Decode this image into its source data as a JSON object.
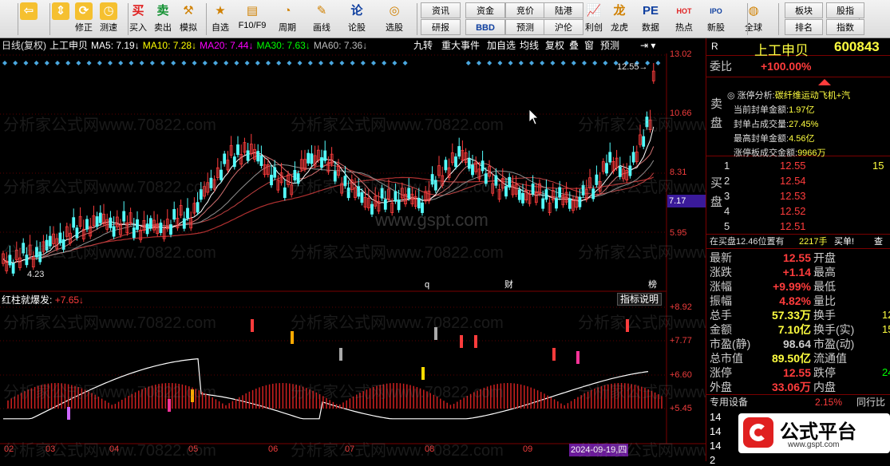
{
  "toolbar": {
    "items": [
      {
        "label": "",
        "icon": "back-arrow-icon"
      },
      {
        "label": "",
        "icon": "up-down-arrows-icon"
      },
      {
        "label": "修正",
        "icon": "refresh-icon"
      },
      {
        "label": "测速",
        "icon": "clock-icon"
      },
      {
        "label": "买入",
        "icon": "buy-icon",
        "glyph": "买"
      },
      {
        "label": "卖出",
        "icon": "sell-icon",
        "glyph": "卖"
      },
      {
        "label": "模拟",
        "icon": "gavel-icon"
      },
      {
        "label": "自选",
        "icon": "star-folder-icon"
      },
      {
        "label": "F10/F9",
        "icon": "f10-icon"
      },
      {
        "label": "周期",
        "icon": "cycle-icon"
      },
      {
        "label": "画线",
        "icon": "pen-icon"
      },
      {
        "label": "论股",
        "icon": "forum-icon",
        "glyph": "论"
      },
      {
        "label": "选股",
        "icon": "picker-icon"
      },
      {
        "label": "利创",
        "icon": "chart-icon"
      },
      {
        "label": "龙虎",
        "icon": "dragon-icon"
      },
      {
        "label": "数据",
        "icon": "pe-icon",
        "glyph": "PE"
      },
      {
        "label": "热点",
        "icon": "hot-icon",
        "glyph": "HOT"
      },
      {
        "label": "新股",
        "icon": "ipo-icon",
        "glyph": "IPO"
      },
      {
        "label": "全球",
        "icon": "globe-icon"
      }
    ],
    "small_buttons": [
      "资讯",
      "资金",
      "竞价",
      "陆港",
      "研报",
      "BBD",
      "预测",
      "沪伦",
      "板块",
      "股指",
      "排名",
      "指数"
    ]
  },
  "chart_header": {
    "title": "日线(复权)",
    "stock": "上工申贝",
    "ma5": "MA5: 7.19↓",
    "ma10": "MA10: 7.28↓",
    "ma20": "MA20: 7.44↓",
    "ma30": "MA30: 7.63↓",
    "ma60": "MA60: 7.36↓",
    "buttons": [
      "九转",
      "重大事件",
      "加自选",
      "均线",
      "复权",
      "叠",
      "窗",
      "预测"
    ]
  },
  "price_axis": [
    "13.02",
    "10.66",
    "8.31",
    "7.17",
    "5.95"
  ],
  "current_price_tag": "7.17",
  "high_marker": "12.55",
  "low_marker": "4.23",
  "event_marks": [
    "q",
    "财",
    "榜"
  ],
  "indicator": {
    "name": "红柱就爆发:",
    "value": "+7.65↓",
    "button": "指标说明",
    "axis": [
      "+8.92",
      "+7.77",
      "+6.60",
      "+5.45"
    ]
  },
  "date_axis": [
    "02",
    "03",
    "04",
    "05",
    "06",
    "07",
    "08",
    "09"
  ],
  "cursor_date": "2024-09-19,四",
  "watermark": "分析家公式网www.70822.com",
  "watermark_center": "www.gspt.com",
  "logo_text": "公式平台",
  "logo_url": "www.gspt.com",
  "colors": {
    "up": "#ff3c3c",
    "down": "#54ffff",
    "ma5": "#ffffff",
    "ma10": "#ffff00",
    "ma20": "#ff00ff",
    "ma30": "#00ff00",
    "ma60": "#808080"
  },
  "quote": {
    "r_label": "R",
    "name": "上工申贝",
    "code": "600843",
    "weibi_label": "委比",
    "weibi": "+100.00%",
    "sell_label": "卖盘",
    "buy_label": "买盘",
    "limit_info": {
      "title": "涨停分析:",
      "concept": "碳纤维运动飞机+汽",
      "lines": [
        {
          "label": "当前封单金额:",
          "value": "1.97亿"
        },
        {
          "label": "封单占成交量:",
          "value": "27.45%"
        },
        {
          "label": "最高封单金额:",
          "value": "4.56亿"
        },
        {
          "label": "涨停板成交金额:",
          "value": "9966万"
        }
      ]
    },
    "bids": [
      {
        "level": "1",
        "price": "12.55",
        "vol": "15"
      },
      {
        "level": "2",
        "price": "12.54",
        "vol": ""
      },
      {
        "level": "3",
        "price": "12.53",
        "vol": ""
      },
      {
        "level": "4",
        "price": "12.52",
        "vol": ""
      },
      {
        "level": "5",
        "price": "12.51",
        "vol": ""
      }
    ],
    "buy_line": {
      "text": "在买盘12.46位置有",
      "qty": "2217手",
      "action": "买单!",
      "query": "查"
    },
    "stats": [
      {
        "l": "最新",
        "v": "12.55",
        "r": "开盘",
        "vc": "#ff3c3c"
      },
      {
        "l": "涨跌",
        "v": "+1.14",
        "r": "最高",
        "vc": "#ff3c3c"
      },
      {
        "l": "涨幅",
        "v": "+9.99%",
        "r": "最低",
        "vc": "#ff3c3c"
      },
      {
        "l": "振幅",
        "v": "4.82%",
        "r": "量比",
        "vc": "#ff3c3c"
      },
      {
        "l": "总手",
        "v": "57.33万",
        "r": "换手",
        "vc": "#ffff40"
      },
      {
        "l": "金额",
        "v": "7.10亿",
        "r": "换手(实)",
        "vc": "#ffff40"
      },
      {
        "l": "市盈(静)",
        "v": "98.64",
        "r": "市盈(动)",
        "vc": "#ccc"
      },
      {
        "l": "总市值",
        "v": "89.50亿",
        "r": "流通值",
        "vc": "#ffff40"
      },
      {
        "l": "涨停",
        "v": "12.55",
        "r": "跌停",
        "vc": "#ff3c3c"
      },
      {
        "l": "外盘",
        "v": "33.06万",
        "r": "内盘",
        "vc": "#ff3c3c"
      }
    ],
    "right_vals": [
      "12",
      "15",
      "24"
    ],
    "equip": {
      "label": "专用设备",
      "value": "2.15%",
      "peer": "同行比"
    },
    "mini_rows": [
      "14",
      "14",
      "14",
      "2"
    ]
  }
}
